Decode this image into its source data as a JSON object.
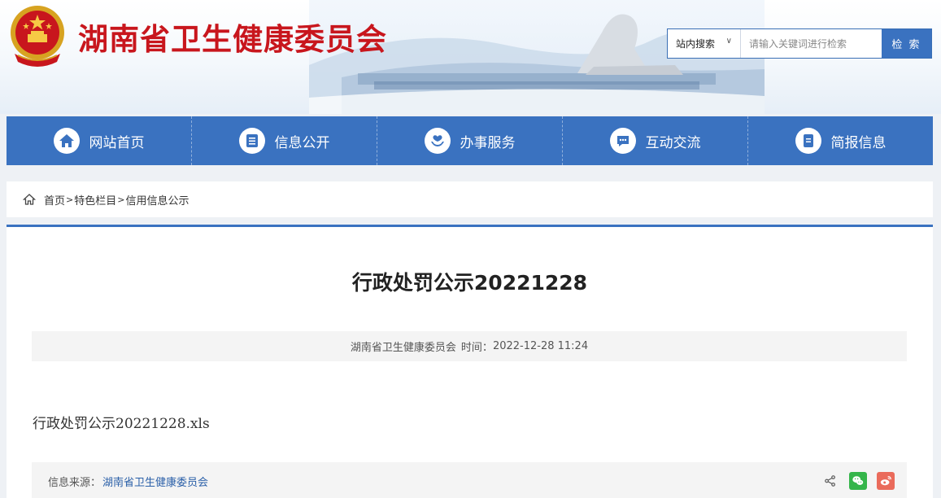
{
  "header": {
    "site_title": "湖南省卫生健康委员会",
    "emblem_icon": "national-emblem-icon"
  },
  "search": {
    "scope_label": "站内搜索",
    "placeholder": "请输入关键词进行检索",
    "button_label": "检 索"
  },
  "nav": {
    "items": [
      {
        "label": "网站首页",
        "icon": "home-icon"
      },
      {
        "label": "信息公开",
        "icon": "document-list-icon"
      },
      {
        "label": "办事服务",
        "icon": "hands-heart-icon"
      },
      {
        "label": "互动交流",
        "icon": "chat-bubble-icon"
      },
      {
        "label": "简报信息",
        "icon": "bulletin-icon"
      }
    ]
  },
  "breadcrumb": {
    "items": [
      "首页",
      "特色栏目",
      "信用信息公示"
    ],
    "separator": ">"
  },
  "article": {
    "title": "行政处罚公示20221228",
    "publisher": "湖南省卫生健康委员会",
    "time_label": "时间：",
    "time_value": "2022-12-28 11:24",
    "attachment": "行政处罚公示20221228.xls",
    "source_label": "信息来源：",
    "source_value": "湖南省卫生健康委员会"
  },
  "colors": {
    "brand_blue": "#3a72c0",
    "title_red": "#c8161d",
    "wechat_green": "#34b54a",
    "weibo_red": "#ea6b5b"
  }
}
